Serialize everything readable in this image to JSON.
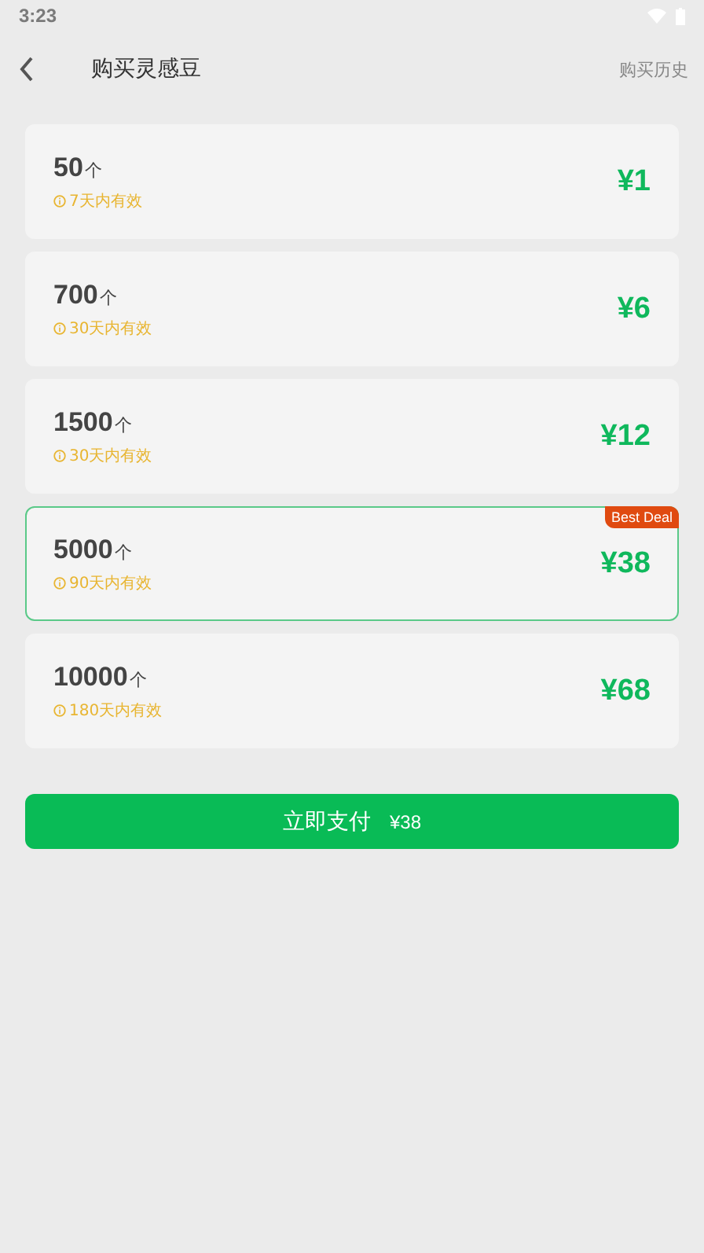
{
  "status_bar": {
    "time": "3:23"
  },
  "header": {
    "title": "购买灵感豆",
    "action": "购买历史"
  },
  "packages": [
    {
      "amount": "50",
      "unit": "个",
      "validity": "7天内有效",
      "price": "¥1",
      "selected": false
    },
    {
      "amount": "700",
      "unit": "个",
      "validity": "30天内有效",
      "price": "¥6",
      "selected": false
    },
    {
      "amount": "1500",
      "unit": "个",
      "validity": "30天内有效",
      "price": "¥12",
      "selected": false
    },
    {
      "amount": "5000",
      "unit": "个",
      "validity": "90天内有效",
      "price": "¥38",
      "selected": true,
      "badge": "Best Deal"
    },
    {
      "amount": "10000",
      "unit": "个",
      "validity": "180天内有效",
      "price": "¥68",
      "selected": false
    }
  ],
  "pay_button": {
    "label": "立即支付",
    "price": "¥38"
  }
}
